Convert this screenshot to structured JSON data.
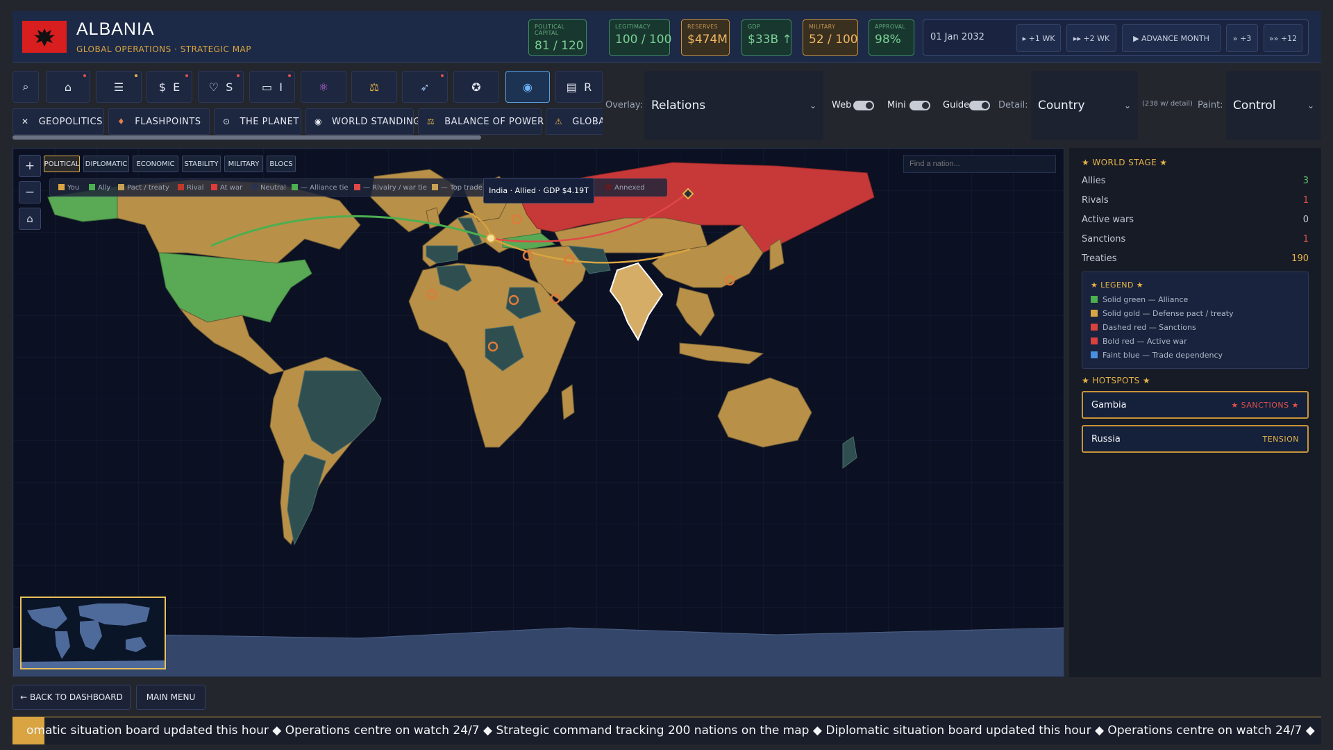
{
  "header": {
    "title": "ALBANIA",
    "subtitle": "GLOBAL OPERATIONS · STRATEGIC MAP",
    "stats": [
      {
        "label": "POLITICAL CAPITAL",
        "value": "81 / 120"
      },
      {
        "label": "LEGITIMACY",
        "value": "100 / 100"
      },
      {
        "label": "RESERVES",
        "value": "$474M"
      },
      {
        "label": "GDP",
        "value": "$33B ↑"
      },
      {
        "label": "MILITARY",
        "value": "52 / 100"
      },
      {
        "label": "APPROVAL",
        "value": "98%"
      }
    ],
    "date": "01 Jan 2032",
    "time_buttons": [
      "+1 WK",
      "+2 WK",
      "ADVANCE MONTH",
      "+3",
      "+12"
    ]
  },
  "icon_tabs": [
    {
      "icon": "search-icon",
      "glyph": "⌕",
      "letter": ""
    },
    {
      "icon": "home-icon",
      "glyph": "⌂",
      "letter": ""
    },
    {
      "icon": "list-icon",
      "glyph": "☰",
      "letter": ""
    },
    {
      "icon": "dollar-icon",
      "glyph": "$",
      "letter": "E"
    },
    {
      "icon": "heart-icon",
      "glyph": "♡",
      "letter": "S"
    },
    {
      "icon": "tank-icon",
      "glyph": "▭",
      "letter": "I"
    },
    {
      "icon": "atom-icon",
      "glyph": "⚛",
      "letter": ""
    },
    {
      "icon": "scales-icon",
      "glyph": "⚖",
      "letter": ""
    },
    {
      "icon": "rocket-icon",
      "glyph": "➶",
      "letter": ""
    },
    {
      "icon": "gear-icon",
      "glyph": "✪",
      "letter": ""
    },
    {
      "icon": "globe-icon",
      "glyph": "◉",
      "letter": ""
    },
    {
      "icon": "report-icon",
      "glyph": "▤",
      "letter": "R"
    }
  ],
  "section_tabs": [
    {
      "label": "GEOPOLITICS",
      "icon": "swords-icon",
      "glyph": "✕"
    },
    {
      "label": "FLASHPOINTS",
      "icon": "fire-icon",
      "glyph": "♦"
    },
    {
      "label": "THE PLANET",
      "icon": "planet-icon",
      "glyph": "⊙"
    },
    {
      "label": "WORLD STANDING",
      "icon": "standing-icon",
      "glyph": "◉"
    },
    {
      "label": "BALANCE OF POWER",
      "icon": "balance-icon",
      "glyph": "⚖"
    },
    {
      "label": "GLOBAL R",
      "icon": "warning-icon",
      "glyph": "⚠"
    }
  ],
  "toolbar": {
    "overlay_label": "Overlay:",
    "overlay_value": "Relations",
    "web_label": "Web",
    "mini_label": "Mini",
    "guide_label": "Guide",
    "detail_label": "Detail:",
    "detail_value": "Country",
    "detail_note": "(238 w/ detail)",
    "paint_label": "Paint:",
    "paint_value": "Control"
  },
  "map": {
    "mode_tabs": [
      "POLITICAL",
      "DIPLOMATIC",
      "ECONOMIC",
      "STABILITY",
      "MILITARY",
      "BLOCS"
    ],
    "legend": [
      {
        "label": "You",
        "color": "#d9a441"
      },
      {
        "label": "Ally",
        "color": "#4caf50"
      },
      {
        "label": "Pact / treaty",
        "color": "#c7a254"
      },
      {
        "label": "Rival",
        "color": "#c0392b"
      },
      {
        "label": "At war",
        "color": "#e03b3b"
      },
      {
        "label": "Neutral",
        "color": "#2a3350"
      },
      {
        "label": "— Alliance tie",
        "color": "#4caf50"
      },
      {
        "label": "— Rivalry / war tie",
        "color": "#e04848"
      },
      {
        "label": "— Top trade",
        "color": "#c7a254"
      },
      {
        "label": "Annexed",
        "color": "#5a1e25"
      }
    ],
    "tooltip": "India · Allied · GDP $4.19T",
    "search_placeholder": "Find a nation...",
    "zoom_in": "+",
    "zoom_out": "−",
    "home_glyph": "⌂"
  },
  "panel": {
    "world_stage_title": "★ WORLD STAGE ★",
    "rows": [
      {
        "label": "Allies",
        "value": "3",
        "color": "#5cc46e"
      },
      {
        "label": "Rivals",
        "value": "1",
        "color": "#e0524a"
      },
      {
        "label": "Active wars",
        "value": "0",
        "color": "#c2c9d6"
      },
      {
        "label": "Sanctions",
        "value": "1",
        "color": "#e0524a"
      },
      {
        "label": "Treaties",
        "value": "190",
        "color": "#e5b347"
      }
    ],
    "legend_title": "★ LEGEND ★",
    "legend_items": [
      {
        "label": "Solid green — Alliance",
        "color": "#4caf50"
      },
      {
        "label": "Solid gold — Defense pact / treaty",
        "color": "#d9a441"
      },
      {
        "label": "Dashed red — Sanctions",
        "color": "#d9423d"
      },
      {
        "label": "Bold red — Active war",
        "color": "#d9423d"
      },
      {
        "label": "Faint blue — Trade dependency",
        "color": "#4a8fe0"
      }
    ],
    "hotspots_title": "★ HOTSPOTS ★",
    "hotspots": [
      {
        "name": "Gambia",
        "tag": "★ SANCTIONS ★",
        "color": "#e0524a"
      },
      {
        "name": "Russia",
        "tag": "TENSION",
        "color": "#e5b347"
      }
    ]
  },
  "bottom": {
    "back_label": "← BACK TO DASHBOARD",
    "menu_label": "MAIN MENU",
    "ticker": "omatic situation board updated this hour  ◆  Operations centre on watch 24/7  ◆  Strategic command tracking 200 nations on the map  ◆  Diplomatic situation board updated this hour  ◆  Operations centre on watch 24/7  ◆"
  },
  "colors": {
    "ally": "#5aa955",
    "pact": "#b89047",
    "rival": "#c73838",
    "neutral": "#2f4e50",
    "ocean": "#0b1123"
  }
}
